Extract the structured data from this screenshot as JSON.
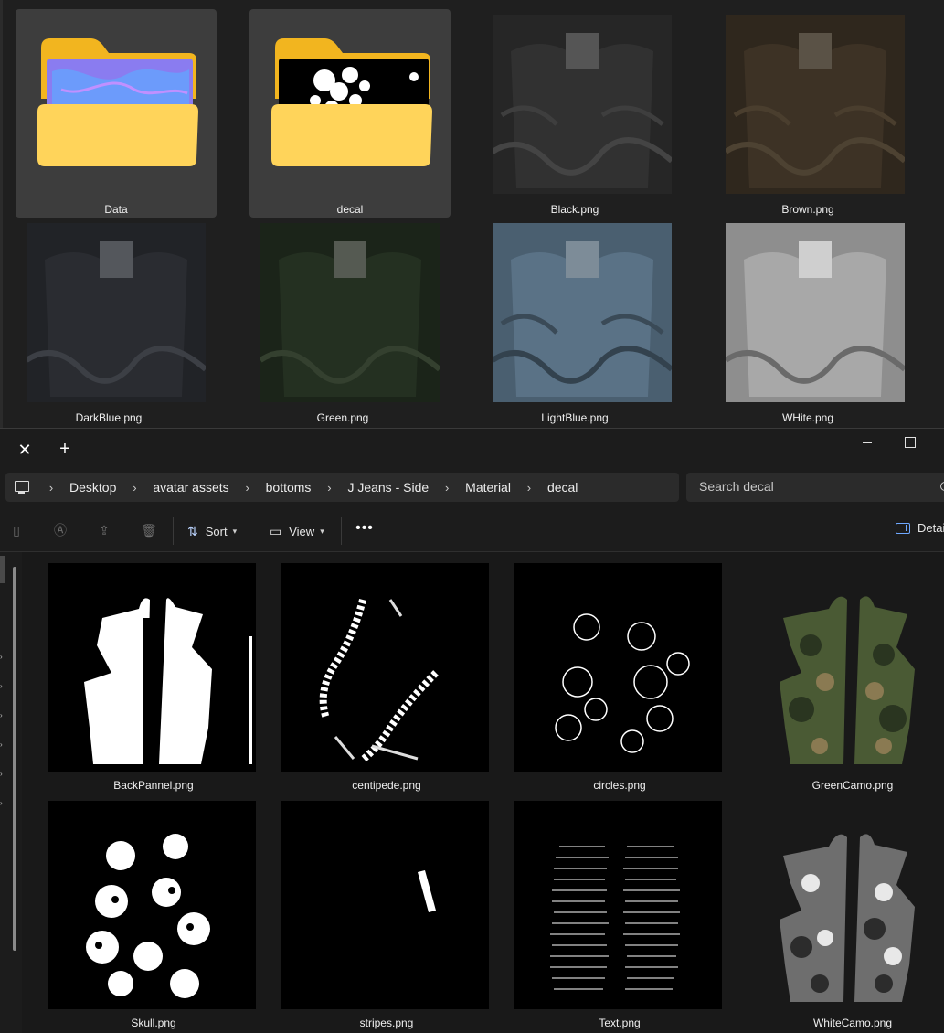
{
  "background_window": {
    "items": [
      {
        "label": "Data",
        "kind": "folder",
        "selected": true
      },
      {
        "label": "decal",
        "kind": "folder",
        "selected": true
      },
      {
        "label": "Black.png",
        "kind": "image",
        "tint": "#2a2a2a"
      },
      {
        "label": "Brown.png",
        "kind": "image",
        "tint": "#3a3024"
      },
      {
        "label": "DarkBlue.png",
        "kind": "image",
        "tint": "#25272b"
      },
      {
        "label": "Green.png",
        "kind": "image",
        "tint": "#1f2a1c"
      },
      {
        "label": "LightBlue.png",
        "kind": "image",
        "tint": "#4f6678"
      },
      {
        "label": "WHite.png",
        "kind": "image",
        "tint": "#9a9a9a"
      }
    ]
  },
  "titlebar": {
    "close_tab_icon": "close-icon",
    "new_tab_icon": "plus-icon"
  },
  "addressbar": {
    "breadcrumbs": [
      "Desktop",
      "avatar assets",
      "bottoms",
      "J Jeans - Side",
      "Material",
      "decal"
    ],
    "search_placeholder": "Search decal"
  },
  "toolbar": {
    "sort_label": "Sort",
    "view_label": "View",
    "more_label": "•••",
    "details_label": "Details"
  },
  "files": [
    {
      "label": "BackPannel.png"
    },
    {
      "label": "centipede.png"
    },
    {
      "label": "circles.png"
    },
    {
      "label": "GreenCamo.png"
    },
    {
      "label": "Skull.png"
    },
    {
      "label": "stripes.png"
    },
    {
      "label": "Text.png"
    },
    {
      "label": "WhiteCamo.png"
    }
  ],
  "colors": {
    "accent": "#6fa8ff",
    "folder_yellow": "#f5c842",
    "window_bg": "#202020"
  }
}
